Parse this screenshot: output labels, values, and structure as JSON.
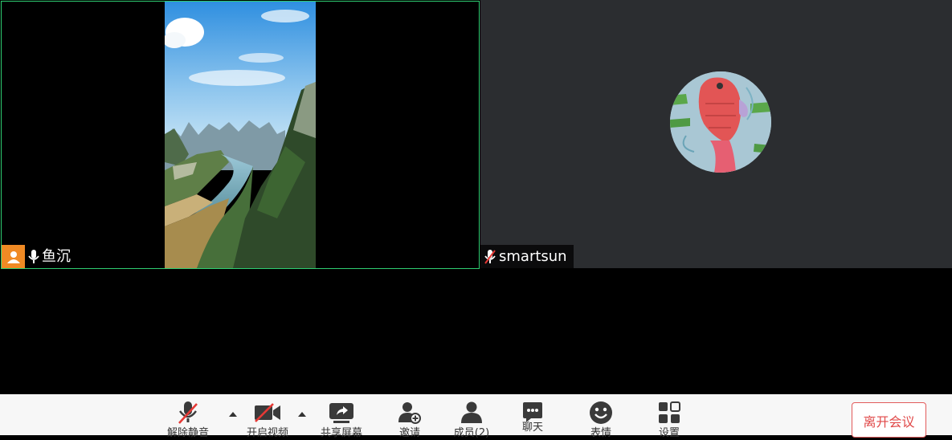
{
  "participants": [
    {
      "name": "鱼沉",
      "muted": false,
      "video_on": true
    },
    {
      "name": "smartsun",
      "muted": true,
      "video_on": false
    }
  ],
  "toolbar": {
    "unmute_label": "解除静音",
    "start_video_label": "开启视频",
    "share_screen_label": "共享屏幕",
    "invite_label": "邀请",
    "members_label": "成员(2)",
    "chat_label": "聊天",
    "emoji_label": "表情",
    "settings_label": "设置",
    "leave_label": "离开会议"
  },
  "colors": {
    "active_border": "#2ecc71",
    "avatar_badge": "#f08a24",
    "leave": "#e04848",
    "muted_red": "#e53935"
  }
}
